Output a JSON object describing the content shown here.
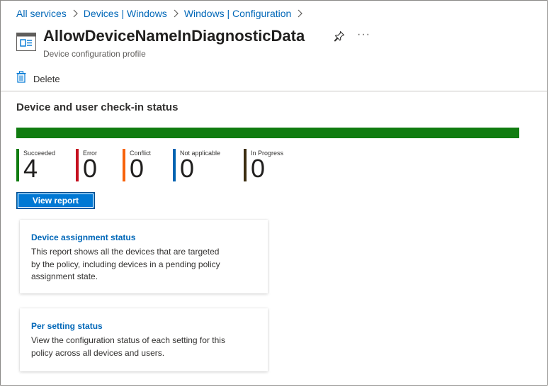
{
  "breadcrumb": {
    "items": [
      "All services",
      "Devices | Windows",
      "Windows | Configuration"
    ]
  },
  "header": {
    "title": "AllowDeviceNameInDiagnosticData",
    "subtitle": "Device configuration profile",
    "more": "···"
  },
  "toolbar": {
    "delete_label": "Delete"
  },
  "status": {
    "section_title": "Device and user check-in status",
    "progress_success_fraction": 1.0,
    "stats": [
      {
        "label": "Succeeded",
        "value": "4",
        "color": "#107c10"
      },
      {
        "label": "Error",
        "value": "0",
        "color": "#c50f1f"
      },
      {
        "label": "Conflict",
        "value": "0",
        "color": "#f7630c"
      },
      {
        "label": "Not applicable",
        "value": "0",
        "color": "#0063b1"
      },
      {
        "label": "In Progress",
        "value": "0",
        "color": "#3b2d10"
      }
    ],
    "view_report_label": "View report"
  },
  "cards": [
    {
      "title": "Device assignment status",
      "description": "This report shows all the devices that are targeted by the policy, including devices in a pending policy assignment state."
    },
    {
      "title": "Per setting status",
      "description": "View the configuration status of each setting for this policy across all devices and users."
    }
  ],
  "colors": {
    "accent": "#0078d4",
    "link": "#0067b8",
    "success": "#107c10"
  }
}
